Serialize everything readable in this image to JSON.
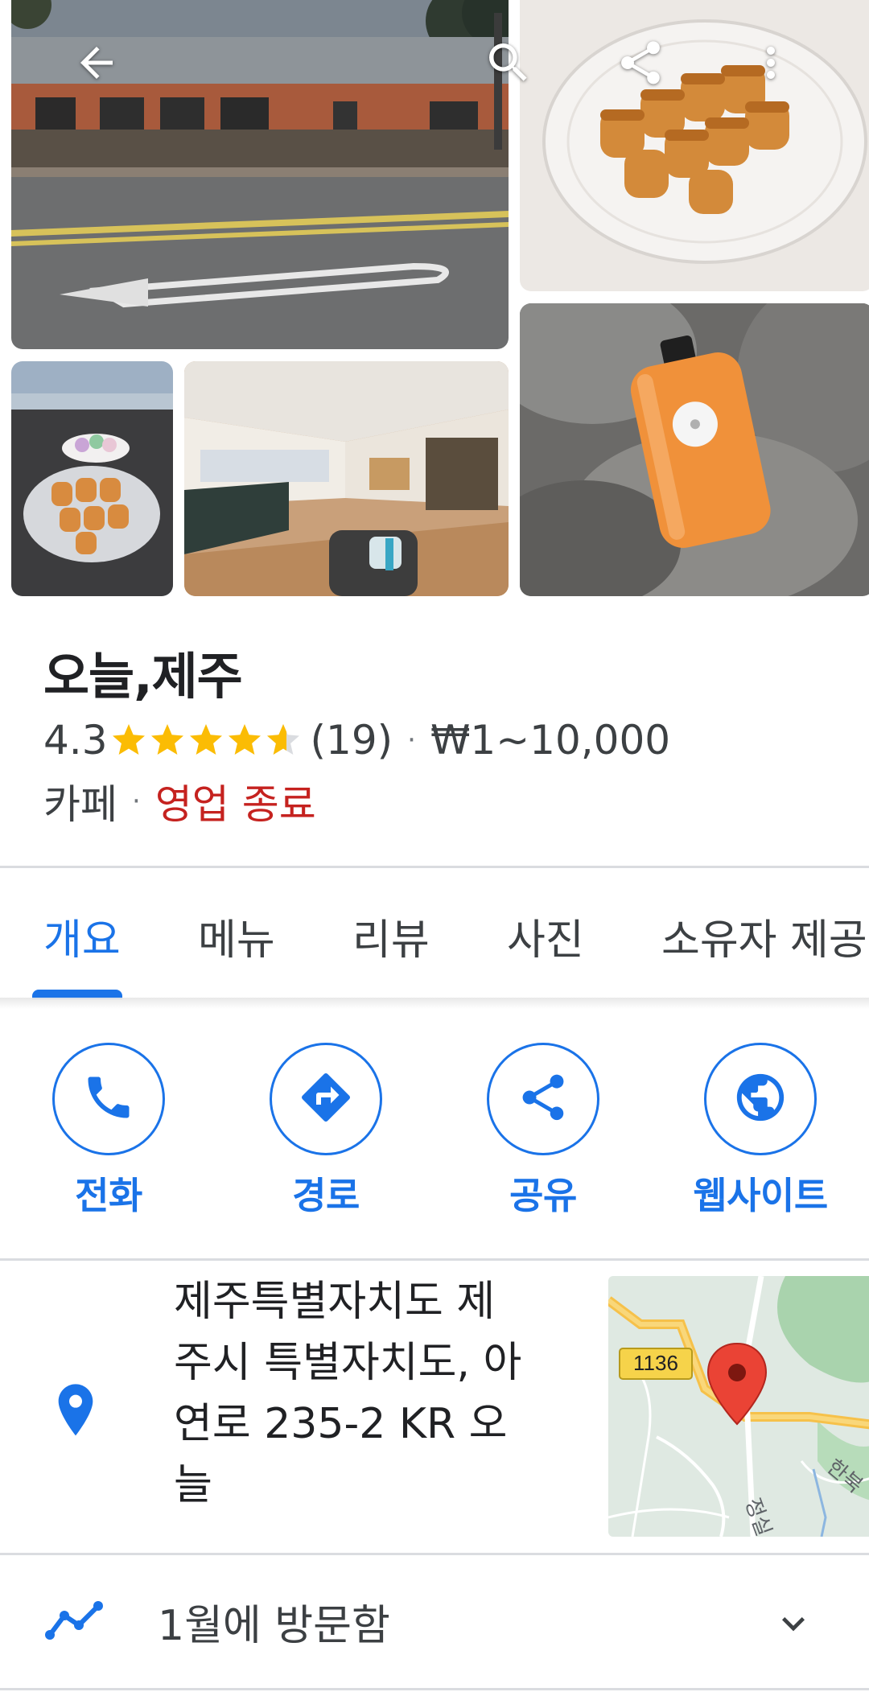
{
  "header": {
    "back_icon": "arrow-back-icon",
    "search_icon": "search-icon",
    "share_icon": "share-icon",
    "more_icon": "more-vert-icon"
  },
  "place": {
    "name": "오늘,제주",
    "rating": "4.3",
    "stars_value": 4.3,
    "reviews": "(19)",
    "price": "₩1~10,000",
    "category": "카페",
    "status": "영업 종료",
    "status_color": "#c5221f"
  },
  "tabs": [
    {
      "label": "개요",
      "active": true
    },
    {
      "label": "메뉴"
    },
    {
      "label": "리뷰"
    },
    {
      "label": "사진"
    },
    {
      "label": "소유자 제공"
    }
  ],
  "actions": [
    {
      "label": "전화",
      "icon": "phone-icon"
    },
    {
      "label": "경로",
      "icon": "directions-icon"
    },
    {
      "label": "공유",
      "icon": "share-icon"
    },
    {
      "label": "웹사이트",
      "icon": "globe-icon"
    }
  ],
  "address": {
    "line1": "제주특별자치도 제",
    "line2": "주시 특별자치도, 아",
    "line3": "연로 235-2 KR 오",
    "line4": "늘",
    "map_route_label": "1136",
    "map_road_label_1": "정실",
    "map_road_label_2": "한북"
  },
  "visited": {
    "label": "1월에 방문함"
  },
  "colors": {
    "accent": "#1a73e8",
    "star": "#fbbc04",
    "closed": "#c5221f"
  }
}
